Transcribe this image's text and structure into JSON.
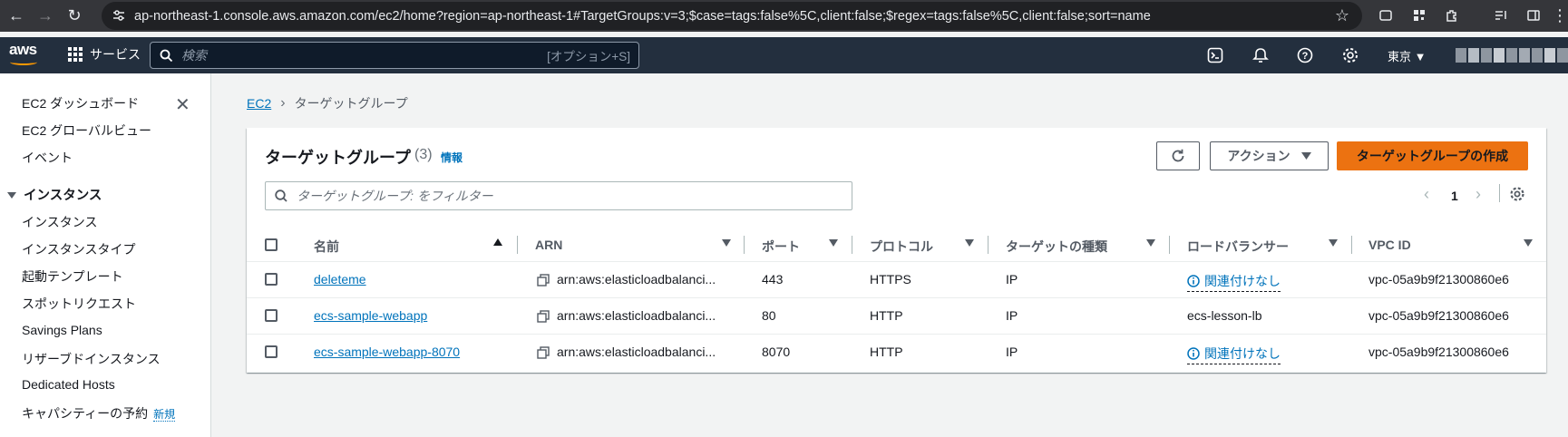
{
  "browser": {
    "url": "ap-northeast-1.console.aws.amazon.com/ec2/home?region=ap-northeast-1#TargetGroups:v=3;$case=tags:false%5C,client:false;$regex=tags:false%5C,client:false;sort=name"
  },
  "topnav": {
    "logo": "aws",
    "services_label": "サービス",
    "search_placeholder": "検索",
    "search_shortcut": "[オプション+S]",
    "region": "東京 ▼"
  },
  "sidebar": {
    "items_top": [
      "EC2 ダッシュボード",
      "EC2 グローバルビュー",
      "イベント"
    ],
    "section_title": "インスタンス",
    "section_items": [
      "インスタンス",
      "インスタンスタイプ",
      "起動テンプレート",
      "スポットリクエスト",
      "Savings Plans",
      "リザーブドインスタンス",
      "Dedicated Hosts",
      "キャパシティーの予約"
    ],
    "new_badge": "新規"
  },
  "breadcrumb": {
    "root": "EC2",
    "current": "ターゲットグループ"
  },
  "panel": {
    "title": "ターゲットグループ",
    "count": "(3)",
    "info": "情報",
    "actions_label": "アクション",
    "create_label": "ターゲットグループの作成",
    "filter_placeholder": "ターゲットグループ: をフィルター",
    "page": "1"
  },
  "table": {
    "columns": [
      "名前",
      "ARN",
      "ポート",
      "プロトコル",
      "ターゲットの種類",
      "ロードバランサー",
      "VPC ID"
    ],
    "rows": [
      {
        "name": "deleteme",
        "arn": "arn:aws:elasticloadbalanci...",
        "port": "443",
        "protocol": "HTTPS",
        "target_type": "IP",
        "lb": "関連付けなし",
        "vpc": "vpc-05a9b9f21300860e6"
      },
      {
        "name": "ecs-sample-webapp",
        "arn": "arn:aws:elasticloadbalanci...",
        "port": "80",
        "protocol": "HTTP",
        "target_type": "IP",
        "lb": "ecs-lesson-lb",
        "vpc": "vpc-05a9b9f21300860e6"
      },
      {
        "name": "ecs-sample-webapp-8070",
        "arn": "arn:aws:elasticloadbalanci...",
        "port": "8070",
        "protocol": "HTTP",
        "target_type": "IP",
        "lb": "関連付けなし",
        "vpc": "vpc-05a9b9f21300860e6"
      }
    ]
  },
  "colors": {
    "aws_nav": "#232f3e",
    "primary": "#ec7211",
    "link": "#0073bb"
  }
}
